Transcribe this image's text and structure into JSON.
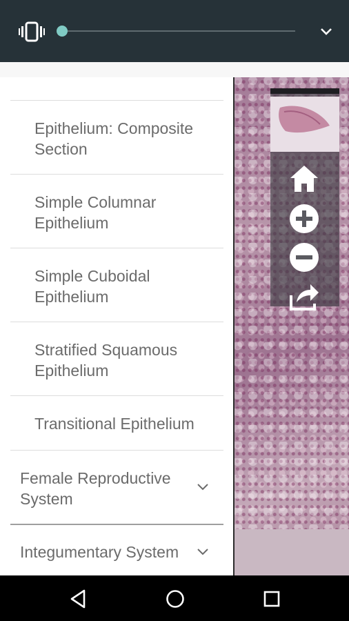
{
  "toolbar": {
    "vibrate_icon": "vibrate-icon",
    "slider_value": 0,
    "expand_icon": "chevron-down-icon"
  },
  "drawer": {
    "items": [
      {
        "label": "Epithelium: Composite Section",
        "type": "slide"
      },
      {
        "label": "Simple Columnar Epithelium",
        "type": "slide"
      },
      {
        "label": "Simple Cuboidal Epithelium",
        "type": "slide"
      },
      {
        "label": "Stratified Squamous Epithelium",
        "type": "slide"
      },
      {
        "label": "Transitional Epithelium",
        "type": "slide"
      },
      {
        "label": "Female Reproductive System",
        "type": "category",
        "icon": "chevron-down-icon"
      },
      {
        "label": "Integumentary System",
        "type": "category",
        "icon": "chevron-down-icon"
      }
    ]
  },
  "viewer": {
    "controls": [
      "home-icon",
      "zoom-in-icon",
      "zoom-out-icon",
      "share-icon"
    ]
  },
  "system_nav": [
    "back-icon",
    "home-circle-icon",
    "recents-icon"
  ],
  "colors": {
    "toolbar": "#263238",
    "accent": "#80cbc4",
    "text": "#6b6b6b"
  }
}
